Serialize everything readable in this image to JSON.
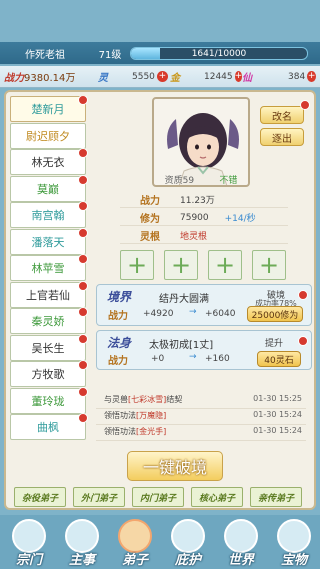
{
  "header": {
    "player_name": "作死老祖",
    "level": "71级",
    "exp_text": "1641/10000",
    "exp_fraction": 0.164
  },
  "resources": {
    "power_label": "战力",
    "power_value": "9380.14万",
    "gem_value": "5550",
    "gold_value": "12445",
    "fire_value": "384"
  },
  "sidebar": {
    "items": [
      {
        "label": "楚新月",
        "color": "teal",
        "dot": true
      },
      {
        "label": "尉迟顾夕",
        "color": "gold",
        "dot": false
      },
      {
        "label": "林无衣",
        "color": "plain",
        "dot": true
      },
      {
        "label": "莫巅",
        "color": "green",
        "dot": true
      },
      {
        "label": "南宫翰",
        "color": "teal",
        "dot": true
      },
      {
        "label": "潘落天",
        "color": "teal",
        "dot": true
      },
      {
        "label": "林苹雪",
        "color": "green",
        "dot": true
      },
      {
        "label": "上官若仙",
        "color": "plain",
        "dot": true
      },
      {
        "label": "秦灵娇",
        "color": "green",
        "dot": true
      },
      {
        "label": "吴长生",
        "color": "plain",
        "dot": true
      },
      {
        "label": "方牧歌",
        "color": "plain",
        "dot": true
      },
      {
        "label": "董玲珑",
        "color": "green",
        "dot": true
      },
      {
        "label": "曲枫",
        "color": "teal",
        "dot": true
      }
    ]
  },
  "character": {
    "quality_label": "资质59",
    "quality_grade": "不错",
    "rename_label": "改名",
    "expel_label": "逐出"
  },
  "stats": {
    "power_label": "战力",
    "power_value": "11.23万",
    "cultivation_label": "修为",
    "cultivation_value": "75900",
    "cultivation_rate": "+14/秒",
    "root_label": "灵根",
    "root_value": "地灵根"
  },
  "realm": {
    "title": "境界",
    "name": "结丹大圆满",
    "break_label": "破境",
    "success_rate": "成功率78%",
    "power_label": "战力",
    "from": "+4920",
    "to": "+6040",
    "btn_label": "25000修为"
  },
  "dharma": {
    "title": "法身",
    "name": "太极初成[1丈]",
    "upgrade_label": "提升",
    "power_label": "战力",
    "from": "+0",
    "to": "+160",
    "btn_label": "40灵石"
  },
  "logs": [
    {
      "pre": "与灵兽",
      "hi": "[七彩冰雪]",
      "post": "结契",
      "time": "01-30 15:25"
    },
    {
      "pre": "领悟功法",
      "hi": "[万魔隐]",
      "post": "",
      "time": "01-30 15:24"
    },
    {
      "pre": "领悟功法",
      "hi": "[金光手]",
      "post": "",
      "time": "01-30 15:24"
    }
  ],
  "action": {
    "label": "一键破境"
  },
  "subtabs": [
    "杂役弟子",
    "外门弟子",
    "内门弟子",
    "核心弟子",
    "亲传弟子"
  ],
  "nav": [
    "宗门",
    "主事",
    "弟子",
    "庇护",
    "世界",
    "宝物"
  ]
}
